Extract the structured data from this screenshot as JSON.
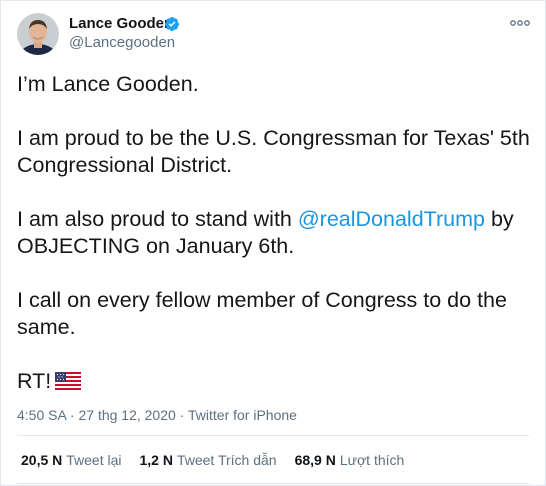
{
  "author": {
    "name": "Lance Gooden",
    "handle": "@Lancegooden"
  },
  "tweet": {
    "line1": "I’m Lance Gooden.",
    "line2": "I am proud to be the U.S. Congressman for Texas' 5th Congressional District.",
    "line3_before": "I am also proud to stand with ",
    "line3_mention": "@realDonaldTrump",
    "line3_after": " by OBJECTING on January 6th.",
    "line4": "I call on every fellow member of Congress to do the same.",
    "line5": "RT!"
  },
  "meta": {
    "time": "4:50 SA · 27 thg 12, 2020",
    "dot": " · ",
    "source": "Twitter for iPhone"
  },
  "stats": {
    "retweets_count": "20,5 N",
    "retweets_label": "Tweet lại",
    "quotes_count": "1,2 N",
    "quotes_label": "Tweet Trích dẫn",
    "likes_count": "68,9 N",
    "likes_label": "Lượt thích"
  },
  "colors": {
    "link": "#1b95e0",
    "secondary_text": "#5b7083",
    "verified": "#1da1f2",
    "border": "#e1e8ed"
  },
  "icons": [
    "verified-badge-icon",
    "more-options-icon",
    "us-flag-emoji"
  ]
}
